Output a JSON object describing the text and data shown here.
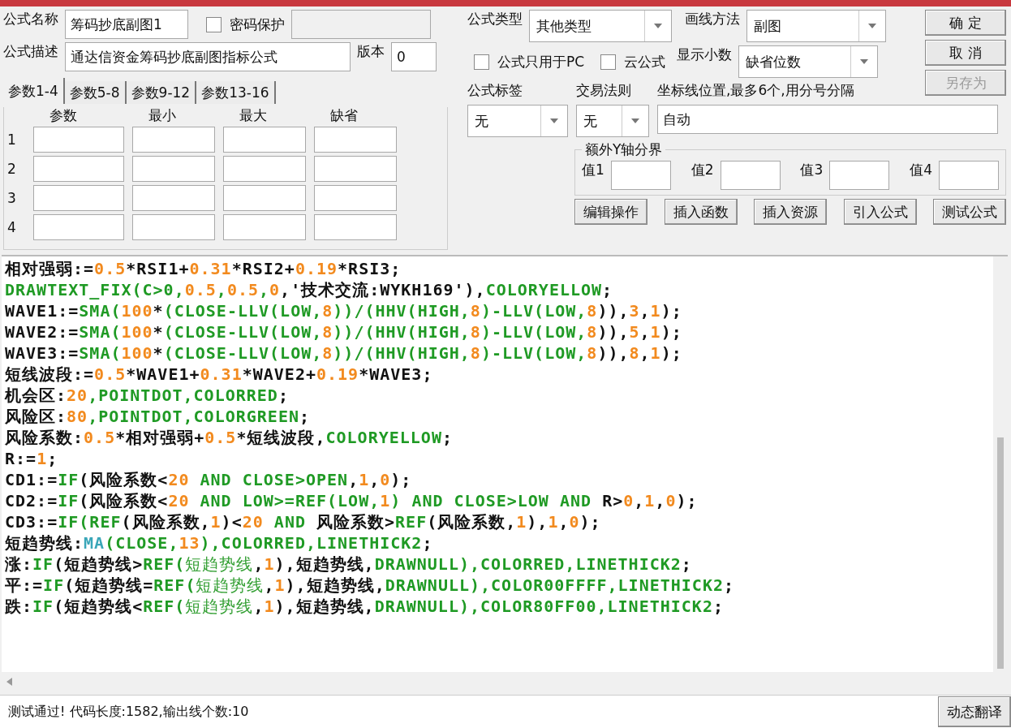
{
  "name": {
    "label": "公式名称",
    "value": "筹码抄底副图1"
  },
  "password": {
    "label": "密码保护",
    "checked": false
  },
  "description": {
    "label": "公式描述",
    "value": "通达信资金筹码抄底副图指标公式"
  },
  "version": {
    "label": "版本",
    "value": "0"
  },
  "param_tabs": [
    {
      "label": "参数1-4",
      "selected": true
    },
    {
      "label": "参数5-8",
      "selected": false
    },
    {
      "label": "参数9-12",
      "selected": false
    },
    {
      "label": "参数13-16",
      "selected": false
    }
  ],
  "param_columns": [
    "参数",
    "最小",
    "最大",
    "缺省"
  ],
  "param_rows": [
    "1",
    "2",
    "3",
    "4"
  ],
  "formula_type": {
    "label": "公式类型",
    "value": "其他类型"
  },
  "draw_method": {
    "label": "画线方法",
    "value": "副图"
  },
  "pc_only": {
    "label": "公式只用于PC",
    "checked": false
  },
  "cloud": {
    "label": "云公式",
    "checked": false
  },
  "decimals": {
    "label": "显示小数",
    "value": "缺省位数"
  },
  "buttons": [
    {
      "label": "确 定",
      "disabled": false
    },
    {
      "label": "取 消",
      "disabled": false
    },
    {
      "label": "另存为",
      "disabled": true
    }
  ],
  "tag": {
    "label": "公式标签",
    "value": "无"
  },
  "trade_rule": {
    "label": "交易法则",
    "value": "无"
  },
  "axis_lines": {
    "label": "坐标线位置,最多6个,用分号分隔",
    "value": "自动"
  },
  "y_bounds": {
    "title": "额外Y轴分界",
    "values": [
      "值1",
      "值2",
      "值3",
      "值4"
    ]
  },
  "tool_buttons": [
    "编辑操作",
    "插入函数",
    "插入资源",
    "引入公式",
    "测试公式"
  ],
  "code_lines": [
    [
      {
        "kind": "plain",
        "text": "相对强弱:="
      },
      {
        "kind": "number",
        "text": "0.5"
      },
      {
        "kind": "plain",
        "text": "*RSI1+"
      },
      {
        "kind": "number",
        "text": "0.31"
      },
      {
        "kind": "plain",
        "text": "*RSI2+"
      },
      {
        "kind": "number",
        "text": "0.19"
      },
      {
        "kind": "plain",
        "text": "*RSI3;"
      }
    ],
    [
      {
        "kind": "function",
        "text": "DRAWTEXT_FIX(C>0,"
      },
      {
        "kind": "number",
        "text": "0.5"
      },
      {
        "kind": "function",
        "text": ","
      },
      {
        "kind": "number",
        "text": "0.5"
      },
      {
        "kind": "function",
        "text": ","
      },
      {
        "kind": "number",
        "text": "0"
      },
      {
        "kind": "plain",
        "text": ",'技术交流:WYKH169'),"
      },
      {
        "kind": "function",
        "text": "COLORYELLOW"
      },
      {
        "kind": "plain",
        "text": ";"
      }
    ],
    [
      {
        "kind": "plain",
        "text": "WAVE1:="
      },
      {
        "kind": "function",
        "text": "SMA("
      },
      {
        "kind": "number",
        "text": "100"
      },
      {
        "kind": "plain",
        "text": "*"
      },
      {
        "kind": "function",
        "text": "(CLOSE-LLV(LOW,"
      },
      {
        "kind": "number",
        "text": "8"
      },
      {
        "kind": "function",
        "text": "))/(HHV(HIGH,"
      },
      {
        "kind": "number",
        "text": "8"
      },
      {
        "kind": "function",
        "text": ")-LLV(LOW,"
      },
      {
        "kind": "number",
        "text": "8"
      },
      {
        "kind": "plain",
        "text": ")),"
      },
      {
        "kind": "number",
        "text": "3"
      },
      {
        "kind": "plain",
        "text": ","
      },
      {
        "kind": "number",
        "text": "1"
      },
      {
        "kind": "plain",
        "text": ");"
      }
    ],
    [
      {
        "kind": "plain",
        "text": "WAVE2:="
      },
      {
        "kind": "function",
        "text": "SMA("
      },
      {
        "kind": "number",
        "text": "100"
      },
      {
        "kind": "plain",
        "text": "*"
      },
      {
        "kind": "function",
        "text": "(CLOSE-LLV(LOW,"
      },
      {
        "kind": "number",
        "text": "8"
      },
      {
        "kind": "function",
        "text": "))/(HHV(HIGH,"
      },
      {
        "kind": "number",
        "text": "8"
      },
      {
        "kind": "function",
        "text": ")-LLV(LOW,"
      },
      {
        "kind": "number",
        "text": "8"
      },
      {
        "kind": "plain",
        "text": ")),"
      },
      {
        "kind": "number",
        "text": "5"
      },
      {
        "kind": "plain",
        "text": ","
      },
      {
        "kind": "number",
        "text": "1"
      },
      {
        "kind": "plain",
        "text": ");"
      }
    ],
    [
      {
        "kind": "plain",
        "text": "WAVE3:="
      },
      {
        "kind": "function",
        "text": "SMA("
      },
      {
        "kind": "number",
        "text": "100"
      },
      {
        "kind": "plain",
        "text": "*"
      },
      {
        "kind": "function",
        "text": "(CLOSE-LLV(LOW,"
      },
      {
        "kind": "number",
        "text": "8"
      },
      {
        "kind": "function",
        "text": "))/(HHV(HIGH,"
      },
      {
        "kind": "number",
        "text": "8"
      },
      {
        "kind": "function",
        "text": ")-LLV(LOW,"
      },
      {
        "kind": "number",
        "text": "8"
      },
      {
        "kind": "plain",
        "text": ")),"
      },
      {
        "kind": "number",
        "text": "8"
      },
      {
        "kind": "plain",
        "text": ","
      },
      {
        "kind": "number",
        "text": "1"
      },
      {
        "kind": "plain",
        "text": ");"
      }
    ],
    [
      {
        "kind": "plain",
        "text": "短线波段:="
      },
      {
        "kind": "number",
        "text": "0.5"
      },
      {
        "kind": "plain",
        "text": "*WAVE1+"
      },
      {
        "kind": "number",
        "text": "0.31"
      },
      {
        "kind": "plain",
        "text": "*WAVE2+"
      },
      {
        "kind": "number",
        "text": "0.19"
      },
      {
        "kind": "plain",
        "text": "*WAVE3;"
      }
    ],
    [
      {
        "kind": "plain",
        "text": "机会区:"
      },
      {
        "kind": "number",
        "text": "20"
      },
      {
        "kind": "function",
        "text": ",POINTDOT,COLORRED"
      },
      {
        "kind": "plain",
        "text": ";"
      }
    ],
    [
      {
        "kind": "plain",
        "text": "风险区:"
      },
      {
        "kind": "number",
        "text": "80"
      },
      {
        "kind": "function",
        "text": ",POINTDOT,COLORGREEN"
      },
      {
        "kind": "plain",
        "text": ";"
      }
    ],
    [
      {
        "kind": "plain",
        "text": "风险系数:"
      },
      {
        "kind": "number",
        "text": "0.5"
      },
      {
        "kind": "plain",
        "text": "*相对强弱+"
      },
      {
        "kind": "number",
        "text": "0.5"
      },
      {
        "kind": "plain",
        "text": "*短线波段,"
      },
      {
        "kind": "function",
        "text": "COLORYELLOW"
      },
      {
        "kind": "plain",
        "text": ";"
      }
    ],
    [
      {
        "kind": "plain",
        "text": "R:="
      },
      {
        "kind": "number",
        "text": "1"
      },
      {
        "kind": "plain",
        "text": ";"
      }
    ],
    [
      {
        "kind": "plain",
        "text": "CD1:="
      },
      {
        "kind": "function",
        "text": "IF"
      },
      {
        "kind": "plain",
        "text": "(风险系数<"
      },
      {
        "kind": "number",
        "text": "20"
      },
      {
        "kind": "function",
        "text": " AND CLOSE>OPEN"
      },
      {
        "kind": "plain",
        "text": ","
      },
      {
        "kind": "number",
        "text": "1"
      },
      {
        "kind": "plain",
        "text": ","
      },
      {
        "kind": "number",
        "text": "0"
      },
      {
        "kind": "plain",
        "text": ");"
      }
    ],
    [
      {
        "kind": "plain",
        "text": "CD2:="
      },
      {
        "kind": "function",
        "text": "IF"
      },
      {
        "kind": "plain",
        "text": "(风险系数<"
      },
      {
        "kind": "number",
        "text": "20"
      },
      {
        "kind": "function",
        "text": " AND LOW>=REF(LOW,"
      },
      {
        "kind": "number",
        "text": "1"
      },
      {
        "kind": "function",
        "text": ") AND CLOSE>LOW AND "
      },
      {
        "kind": "plain",
        "text": "R>"
      },
      {
        "kind": "number",
        "text": "0"
      },
      {
        "kind": "plain",
        "text": ","
      },
      {
        "kind": "number",
        "text": "1"
      },
      {
        "kind": "plain",
        "text": ","
      },
      {
        "kind": "number",
        "text": "0"
      },
      {
        "kind": "plain",
        "text": ");"
      }
    ],
    [
      {
        "kind": "plain",
        "text": "CD3:="
      },
      {
        "kind": "function",
        "text": "IF(REF"
      },
      {
        "kind": "plain",
        "text": "(风险系数,"
      },
      {
        "kind": "number",
        "text": "1"
      },
      {
        "kind": "plain",
        "text": ")<"
      },
      {
        "kind": "number",
        "text": "20"
      },
      {
        "kind": "function",
        "text": " AND "
      },
      {
        "kind": "plain",
        "text": "风险系数>"
      },
      {
        "kind": "function",
        "text": "REF"
      },
      {
        "kind": "plain",
        "text": "(风险系数,"
      },
      {
        "kind": "number",
        "text": "1"
      },
      {
        "kind": "plain",
        "text": "),"
      },
      {
        "kind": "number",
        "text": "1"
      },
      {
        "kind": "plain",
        "text": ","
      },
      {
        "kind": "number",
        "text": "0"
      },
      {
        "kind": "plain",
        "text": ");"
      }
    ],
    [
      {
        "kind": "plain",
        "text": "短趋势线:"
      },
      {
        "kind": "builtin",
        "text": "MA"
      },
      {
        "kind": "function",
        "text": "(CLOSE,"
      },
      {
        "kind": "number",
        "text": "13"
      },
      {
        "kind": "function",
        "text": "),COLORRED,LINETHICK2"
      },
      {
        "kind": "plain",
        "text": ";"
      }
    ],
    [
      {
        "kind": "plain",
        "text": "涨:"
      },
      {
        "kind": "function",
        "text": "IF"
      },
      {
        "kind": "plain",
        "text": "(短趋势线>"
      },
      {
        "kind": "function",
        "text": "REF("
      },
      {
        "kind": "argument",
        "text": "短趋势线"
      },
      {
        "kind": "plain",
        "text": ","
      },
      {
        "kind": "number",
        "text": "1"
      },
      {
        "kind": "plain",
        "text": "),短趋势线,"
      },
      {
        "kind": "function",
        "text": "DRAWNULL),COLORRED,LINETHICK2"
      },
      {
        "kind": "plain",
        "text": ";"
      }
    ],
    [
      {
        "kind": "plain",
        "text": "平:="
      },
      {
        "kind": "function",
        "text": "IF"
      },
      {
        "kind": "plain",
        "text": "(短趋势线="
      },
      {
        "kind": "function",
        "text": "REF("
      },
      {
        "kind": "argument",
        "text": "短趋势线"
      },
      {
        "kind": "plain",
        "text": ","
      },
      {
        "kind": "number",
        "text": "1"
      },
      {
        "kind": "plain",
        "text": "),短趋势线,"
      },
      {
        "kind": "function",
        "text": "DRAWNULL),COLOR00FFFF,LINETHICK2"
      },
      {
        "kind": "plain",
        "text": ";"
      }
    ],
    [
      {
        "kind": "plain",
        "text": "跌:"
      },
      {
        "kind": "function",
        "text": "IF"
      },
      {
        "kind": "plain",
        "text": "(短趋势线<"
      },
      {
        "kind": "function",
        "text": "REF("
      },
      {
        "kind": "argument",
        "text": "短趋势线"
      },
      {
        "kind": "plain",
        "text": ","
      },
      {
        "kind": "number",
        "text": "1"
      },
      {
        "kind": "plain",
        "text": "),短趋势线,"
      },
      {
        "kind": "function",
        "text": "DRAWNULL),COLOR80FF00,LINETHICK2"
      },
      {
        "kind": "plain",
        "text": ";"
      }
    ]
  ],
  "status": {
    "text": "测试通过! 代码长度:1582,输出线个数:10",
    "button": "动态翻译"
  }
}
